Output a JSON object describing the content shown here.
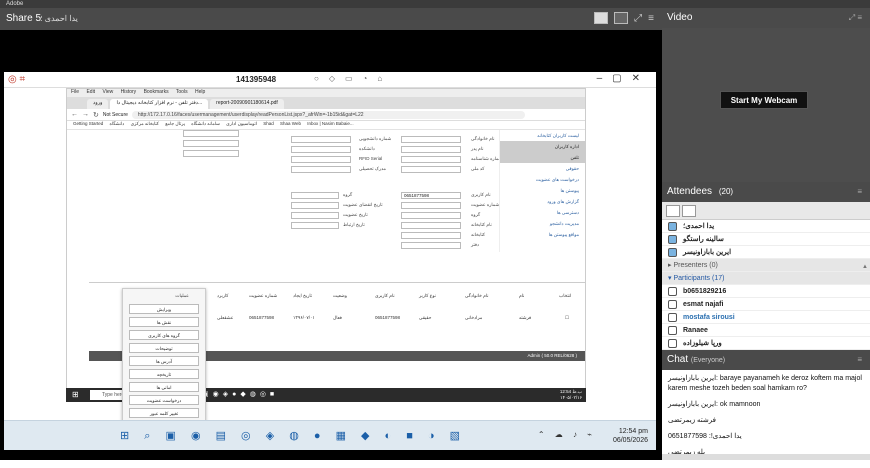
{
  "top_title": "Adobe",
  "share": {
    "title": "Share 5",
    "subtitle": "یدا احمدی ؛"
  },
  "meeting": {
    "id": "141395948"
  },
  "browser": {
    "menu": [
      "File",
      "Edit",
      "View",
      "History",
      "Bookmarks",
      "Tools",
      "Help"
    ],
    "tabs": [
      {
        "label": "ورود"
      },
      {
        "label": "دفتر تلفن - نرم افزار کتابخانه دیجیتال دا..."
      },
      {
        "label": "report-20090901180614.pdf"
      }
    ],
    "not_secure": "Not Secure",
    "url": "http://172.17.0.16/faces/usermanagement/userdisplay/readPersonList.jspx?_afrWin=-1b15id&gat=L22",
    "bookmarks": [
      "Getting Started",
      "اتوماسیون اداری",
      "سامانه دانشگاه",
      "پرتال جامع",
      "کتابخانه مرکزی",
      "دانشگاه",
      "Shad",
      "Shaa Web",
      "Inbox | Nasim Babaie..."
    ]
  },
  "form": {
    "labels": [
      "نام خانوادگی",
      "نام پدر",
      "شماره شناسنامه",
      "کد ملی",
      "نام کاربری",
      "شماره عضویت",
      "گروه",
      "نام کتابخانه",
      "کتابخانه",
      "دفتر",
      "شماره دانشجویی",
      "دانشکده",
      "RFID Serial",
      "مدرک تحصیلی",
      "تاریخ انقضای عضویت",
      "تاریخ عضویت",
      "تاریخ ارتباط"
    ],
    "username_value": "0651877598"
  },
  "sidemenu": {
    "items": [
      "لیست کاربران کتابخانه",
      "اداره کاربران",
      "تلفن",
      "حقوقی",
      "درخواست های عضویت",
      "پیوستن ها",
      "گزارش های ورود",
      "دسترسی ها",
      "مدیریت دانشجو",
      "مواقع پیوستن ها"
    ]
  },
  "table": {
    "headers": [
      "انتخاب",
      "نام",
      "نام خانوادگی",
      "نوع کاربر",
      "نام کاربری",
      "وضعیت",
      "تاریخ ایجاد",
      "شماره عضویت",
      "کاربرد",
      "نقش"
    ],
    "row": [
      "فرشته",
      "مرادخانی",
      "حقیقی",
      "0651877598",
      "فعال",
      "۱۳۹۶/۰۷/۰۱",
      "0651877598",
      "عشقعلی",
      ""
    ]
  },
  "footer_text": "Admin ( 50.0 REL/0628 )",
  "popup": {
    "title": "عملیات",
    "buttons": [
      "ویرایش",
      "نقش ها",
      "گروه های کاربری",
      "توضیحات",
      "آدرس ها",
      "تاریخچه",
      "امانی ها",
      "درخواست عضویت",
      "تغییر کلمه عبور",
      "انتقال کاربر"
    ]
  },
  "guest_taskbar": {
    "search": "Type here to search",
    "time": "12:54 ب.ظ",
    "date": "۱۴۰۵/۰۲/۱۶"
  },
  "host_taskbar": {
    "time": "12:54 pm",
    "date": "06/05/2026"
  },
  "video": {
    "title": "Video",
    "webcam_button": "Start My Webcam"
  },
  "attendees": {
    "title": "Attendees",
    "count": "(20)",
    "me": "یدا احمدی؛",
    "hosts": [
      "سالینه راستگو",
      "ایرین بابازاونیسر"
    ],
    "presenters_label": "Presenters (0)",
    "participants_label": "Participants (17)",
    "participants": [
      "b0651829216",
      "esmat najafi",
      "mostafa sirousi",
      "Ranaee",
      "ورپا شیلوزاده"
    ]
  },
  "chat": {
    "title": "Chat",
    "scope": "(Everyone)",
    "messages": [
      "ایرین بابازاونیسر: baraye payanameh ke deroz koftem ma majol karem meshe tozeh beden soal hamkarn ro?",
      "ایرین بابازاونیسر: ok mamnoon",
      "فرشته زیمرتضی",
      "یدا احمدی!: 0651877598",
      "بله زیمرتضی"
    ]
  }
}
